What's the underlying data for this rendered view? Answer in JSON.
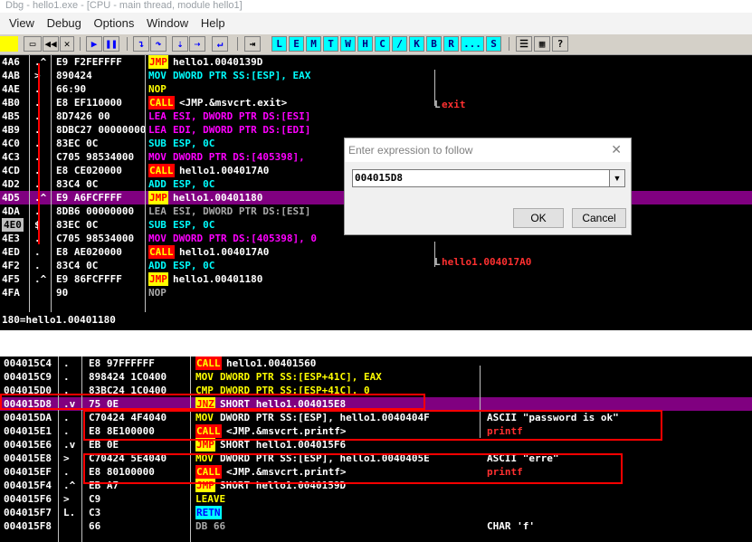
{
  "window": {
    "title": "Dbg - hello1.exe - [CPU - main thread, module hello1]"
  },
  "menu": [
    "View",
    "Debug",
    "Options",
    "Window",
    "Help"
  ],
  "toolbar": {
    "letters": [
      "L",
      "E",
      "M",
      "T",
      "W",
      "H",
      "C",
      "/",
      "K",
      "B",
      "R",
      "...",
      "S"
    ]
  },
  "top_pane": {
    "rows": [
      {
        "addr": "4A6",
        "mark": ".^",
        "hex": "E9 F2FEFFFF",
        "mn": "JMP",
        "mnc": "jmp",
        "ops": "hello1.0040139D",
        "opc": "c-w",
        "hl": false,
        "addrbox": false
      },
      {
        "addr": "4AB",
        "mark": ">",
        "hex": "890424",
        "mn": "MOV",
        "mnc": "c-c",
        "ops": "DWORD PTR SS:[ESP], EAX",
        "opc": "c-c",
        "hl": false,
        "addrbox": false
      },
      {
        "addr": "4AE",
        "mark": ".",
        "hex": "66:90",
        "mn": "NOP",
        "mnc": "c-y",
        "ops": "",
        "opc": "c-w",
        "hl": false,
        "addrbox": false
      },
      {
        "addr": "4B0",
        "mark": ".",
        "hex": "E8 EF110000",
        "mn": "CALL",
        "mnc": "call",
        "ops": "<JMP.&msvcrt.exit>",
        "opc": "c-w",
        "hl": false,
        "addrbox": false
      },
      {
        "addr": "4B5",
        "mark": ".",
        "hex": "8D7426 00",
        "mn": "LEA",
        "mnc": "c-m",
        "ops": "ESI, DWORD PTR DS:[ESI]",
        "opc": "c-m",
        "hl": false,
        "addrbox": false
      },
      {
        "addr": "4B9",
        "mark": ".",
        "hex": "8DBC27 00000000",
        "mn": "LEA",
        "mnc": "c-m",
        "ops": "EDI, DWORD PTR DS:[EDI]",
        "opc": "c-m",
        "hl": false,
        "addrbox": false
      },
      {
        "addr": "4C0",
        "mark": ".",
        "hex": "83EC 0C",
        "mn": "SUB",
        "mnc": "c-c",
        "ops": "ESP, 0C",
        "opc": "c-c",
        "hl": false,
        "addrbox": false
      },
      {
        "addr": "4C3",
        "mark": ".",
        "hex": "C705 98534000",
        "mn": "MOV",
        "mnc": "c-m",
        "ops": "DWORD PTR DS:[405398],",
        "opc": "c-m",
        "hl": false,
        "addrbox": false
      },
      {
        "addr": "4CD",
        "mark": ".",
        "hex": "E8 CE020000",
        "mn": "CALL",
        "mnc": "call",
        "ops": "hello1.004017A0",
        "opc": "c-w",
        "hl": false,
        "addrbox": false
      },
      {
        "addr": "4D2",
        "mark": ".",
        "hex": "83C4 0C",
        "mn": "ADD",
        "mnc": "c-c",
        "ops": "ESP, 0C",
        "opc": "c-c",
        "hl": false,
        "addrbox": false
      },
      {
        "addr": "4D5",
        "mark": ".^",
        "hex": "E9 A6FCFFFF",
        "mn": "JMP",
        "mnc": "jmp",
        "ops": "hello1.00401180",
        "opc": "c-w",
        "hl": true,
        "addrbox": false
      },
      {
        "addr": "4DA",
        "mark": ".",
        "hex": "8DB6 00000000",
        "mn": "LEA",
        "mnc": "c-g",
        "ops": "ESI, DWORD PTR DS:[ESI]",
        "opc": "c-g",
        "hl": false,
        "addrbox": false
      },
      {
        "addr": "4E0",
        "mark": "$",
        "hex": "83EC 0C",
        "mn": "SUB",
        "mnc": "c-c",
        "ops": "ESP, 0C",
        "opc": "c-c",
        "hl": false,
        "addrbox": true
      },
      {
        "addr": "4E3",
        "mark": ".",
        "hex": "C705 98534000",
        "mn": "MOV",
        "mnc": "c-m",
        "ops": "DWORD PTR DS:[405398], 0",
        "opc": "c-m",
        "hl": false,
        "addrbox": false
      },
      {
        "addr": "4ED",
        "mark": ".",
        "hex": "E8 AE020000",
        "mn": "CALL",
        "mnc": "call",
        "ops": "hello1.004017A0",
        "opc": "c-w",
        "hl": false,
        "addrbox": false
      },
      {
        "addr": "4F2",
        "mark": ".",
        "hex": "83C4 0C",
        "mn": "ADD",
        "mnc": "c-c",
        "ops": "ESP, 0C",
        "opc": "c-c",
        "hl": false,
        "addrbox": false
      },
      {
        "addr": "4F5",
        "mark": ".^",
        "hex": "E9 86FCFFFF",
        "mn": "JMP",
        "mnc": "jmp",
        "ops": "hello1.00401180",
        "opc": "c-w",
        "hl": false,
        "addrbox": false
      },
      {
        "addr": "4FA",
        "mark": "",
        "hex": "90",
        "mn": "NOP",
        "mnc": "c-g",
        "ops": "",
        "opc": "c-w",
        "hl": false,
        "addrbox": false
      }
    ],
    "annot_exit": "exit",
    "annot_call": "hello1.004017A0",
    "status": "180=hello1.00401180"
  },
  "bottom_pane": {
    "rows": [
      {
        "addr": "004015C4",
        "mark": ".",
        "hex": "E8 97FFFFFF",
        "mn": "CALL",
        "mnc": "call",
        "ops": "hello1.00401560",
        "opc": "c-w",
        "cm": "",
        "cmc": "c-w",
        "hl": false
      },
      {
        "addr": "004015C9",
        "mark": ".",
        "hex": "898424 1C0400",
        "mn": "MOV",
        "mnc": "c-y",
        "ops": "DWORD PTR SS:[ESP+41C], EAX",
        "opc": "c-y",
        "cm": "",
        "cmc": "c-w",
        "hl": false
      },
      {
        "addr": "004015D0",
        "mark": ".",
        "hex": "83BC24 1C0400",
        "mn": "CMP",
        "mnc": "c-y",
        "ops": "DWORD PTR SS:[ESP+41C], 0",
        "opc": "c-y",
        "cm": "",
        "cmc": "c-w",
        "hl": false
      },
      {
        "addr": "004015D8",
        "mark": ".v",
        "hex": "75 0E",
        "mn": "JNZ",
        "mnc": "jmp",
        "ops": "SHORT hello1.004015E8",
        "opc": "c-w",
        "cm": "",
        "cmc": "c-w",
        "hl": true
      },
      {
        "addr": "004015DA",
        "mark": ".",
        "hex": "C70424 4F4040",
        "mn": "MOV",
        "mnc": "c-y",
        "ops": "DWORD PTR SS:[ESP], hello1.0040404F",
        "opc": "c-w",
        "cm": "ASCII \"password is ok\"",
        "cmc": "c-w",
        "hl": false
      },
      {
        "addr": "004015E1",
        "mark": ".",
        "hex": "E8 8E100000",
        "mn": "CALL",
        "mnc": "call",
        "ops": "<JMP.&msvcrt.printf>",
        "opc": "c-w",
        "cm": "printf",
        "cmc": "c-r",
        "hl": false
      },
      {
        "addr": "004015E6",
        "mark": ".v",
        "hex": "EB 0E",
        "mn": "JMP",
        "mnc": "jmp",
        "ops": "SHORT hello1.004015F6",
        "opc": "c-w",
        "cm": "",
        "cmc": "c-w",
        "hl": false
      },
      {
        "addr": "004015E8",
        "mark": ">",
        "hex": "C70424 5E4040",
        "mn": "MOV",
        "mnc": "c-y",
        "ops": "DWORD PTR SS:[ESP], hello1.0040405E",
        "opc": "c-w",
        "cm": "ASCII \"erre\"",
        "cmc": "c-w",
        "hl": false
      },
      {
        "addr": "004015EF",
        "mark": ".",
        "hex": "E8 80100000",
        "mn": "CALL",
        "mnc": "call",
        "ops": "<JMP.&msvcrt.printf>",
        "opc": "c-w",
        "cm": "printf",
        "cmc": "c-r",
        "hl": false
      },
      {
        "addr": "004015F4",
        "mark": ".^",
        "hex": "EB A7",
        "mn": "JMP",
        "mnc": "jmp",
        "ops": "SHORT hello1.0040159D",
        "opc": "c-w",
        "cm": "",
        "cmc": "c-w",
        "hl": false
      },
      {
        "addr": "004015F6",
        "mark": ">",
        "hex": "C9",
        "mn": "LEAVE",
        "mnc": "c-y",
        "ops": "",
        "opc": "c-w",
        "cm": "",
        "cmc": "c-w",
        "hl": false
      },
      {
        "addr": "004015F7",
        "mark": "L.",
        "hex": "C3",
        "mn": "RETN",
        "mnc": "retn",
        "ops": "",
        "opc": "c-w",
        "cm": "",
        "cmc": "c-w",
        "hl": false
      },
      {
        "addr": "004015F8",
        "mark": "",
        "hex": "66",
        "mn": "DB 66",
        "mnc": "c-g",
        "ops": "",
        "opc": "c-w",
        "cm": "CHAR 'f'",
        "cmc": "c-w",
        "hl": false
      }
    ]
  },
  "dialog": {
    "title": "Enter expression to follow",
    "close": "✕",
    "value": "004015D8",
    "ok": "OK",
    "cancel": "Cancel"
  }
}
